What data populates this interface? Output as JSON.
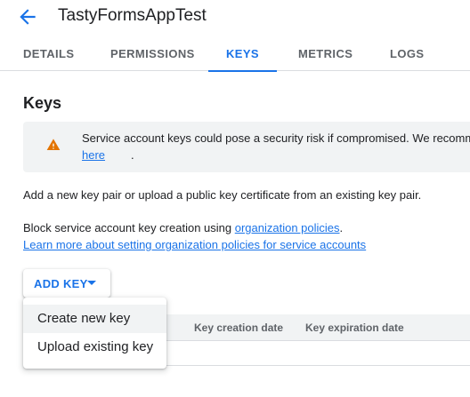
{
  "header": {
    "title": "TastyFormsAppTest",
    "back_icon": "arrow-back-icon"
  },
  "tabs": [
    {
      "label": "DETAILS"
    },
    {
      "label": "PERMISSIONS"
    },
    {
      "label": "KEYS",
      "active": true
    },
    {
      "label": "METRICS"
    },
    {
      "label": "LOGS"
    }
  ],
  "section": {
    "title": "Keys"
  },
  "warning": {
    "icon": "warning-icon",
    "text": "Service account keys could pose a security risk if compromised. We recomm",
    "link": "here",
    "link_suffix": "."
  },
  "description": "Add a new key pair or upload a public key certificate from an existing key pair.",
  "block_text": {
    "prefix": "Block service account key creation using ",
    "link": "organization policies",
    "suffix": "."
  },
  "learn_more_link": "Learn more about setting organization policies for service accounts",
  "add_key": {
    "label": "ADD KEY",
    "icon": "caret-down-icon"
  },
  "menu": {
    "items": [
      {
        "label": "Create new key"
      },
      {
        "label": "Upload existing key"
      }
    ]
  },
  "table": {
    "columns": [
      "Key creation date",
      "Key expiration date"
    ]
  },
  "colors": {
    "accent": "#1a73e8",
    "warning": "#e37400",
    "panel": "#f1f3f4"
  }
}
